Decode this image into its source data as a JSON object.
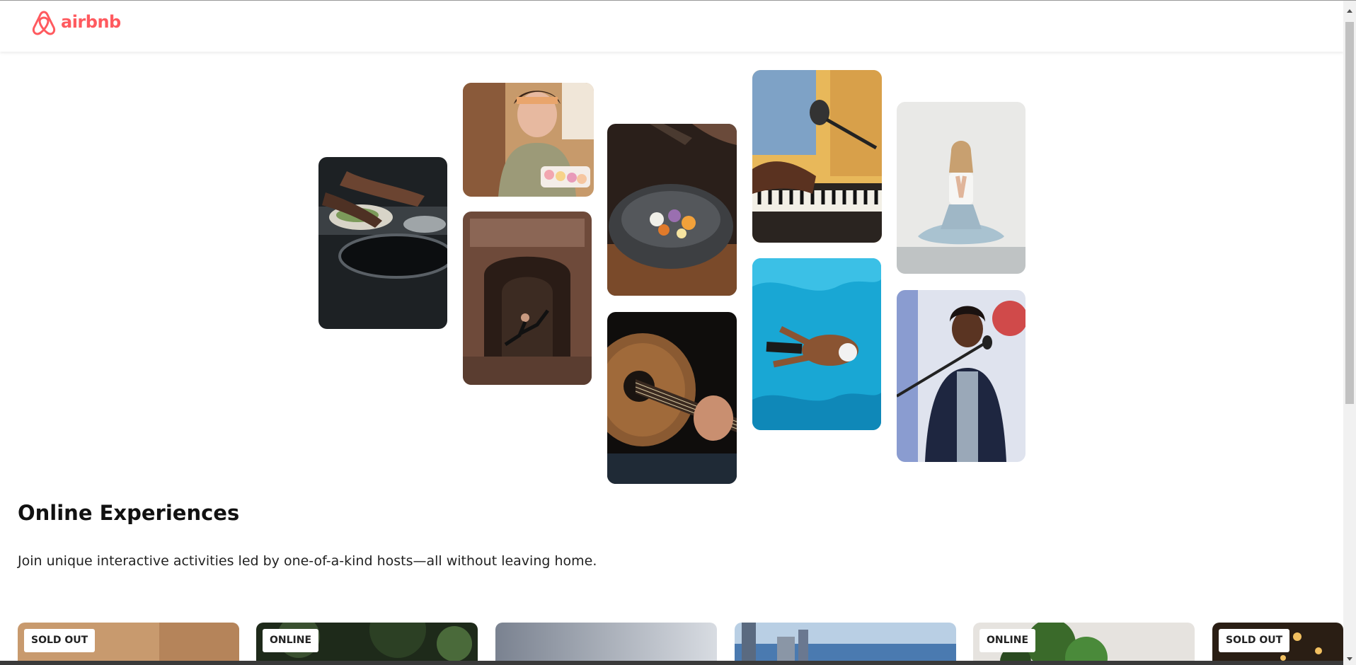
{
  "header": {
    "logo_text": "airbnb",
    "brand_color": "#FF5A5F"
  },
  "collage": {
    "photos": [
      {
        "subject": "hands cooking over pans"
      },
      {
        "subject": "woman holding tray of macarons"
      },
      {
        "subject": "dancer leaping in stone doorway"
      },
      {
        "subject": "seasoning a stone bowl of food"
      },
      {
        "subject": "acoustic guitar being played"
      },
      {
        "subject": "piano keys with microphone"
      },
      {
        "subject": "swimmer in blue pool"
      },
      {
        "subject": "woman meditating in lotus pose"
      },
      {
        "subject": "singer at microphone"
      }
    ]
  },
  "section": {
    "title": "Online Experiences",
    "subtitle": "Join unique interactive activities led by one-of-a-kind hosts—all without leaving home."
  },
  "cards": [
    {
      "badge": "SOLD OUT"
    },
    {
      "badge": "ONLINE"
    },
    {
      "badge": ""
    },
    {
      "badge": ""
    },
    {
      "badge": "ONLINE"
    },
    {
      "badge": "SOLD OUT"
    }
  ]
}
